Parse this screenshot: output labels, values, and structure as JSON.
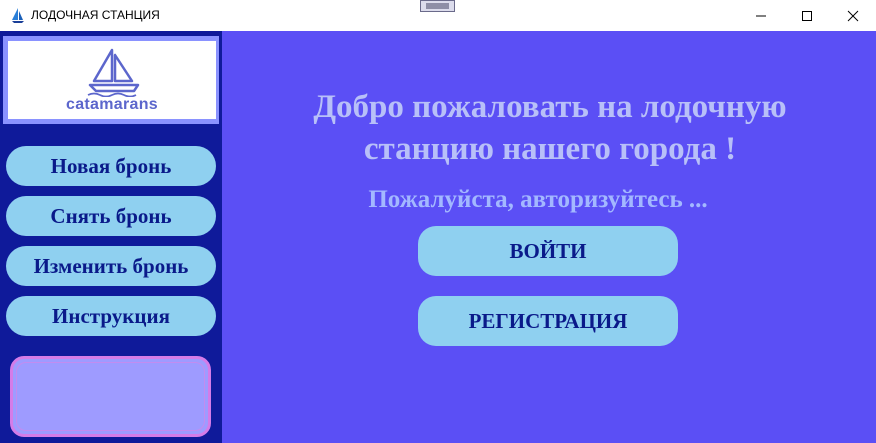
{
  "window": {
    "title": "ЛОДОЧНАЯ СТАНЦИЯ",
    "icon": "sailboat-icon",
    "controls": [
      "minimize-icon",
      "maximize-icon",
      "close-icon"
    ]
  },
  "sidebar": {
    "logo_text": "catamarans",
    "items": [
      {
        "label": "Новая бронь"
      },
      {
        "label": "Снять бронь"
      },
      {
        "label": "Изменить бронь"
      },
      {
        "label": "Инструкция"
      }
    ]
  },
  "main": {
    "heading_line1": "Добро пожаловать на лодочную",
    "heading_line2": "станцию нашего города !",
    "subheading": "Пожалуйста, авторизуйтесь ...",
    "login_label": "ВОЙТИ",
    "register_label": "РЕГИСТРАЦИЯ"
  },
  "colors": {
    "background": "#5b4ff5",
    "sidebar": "#0f1a9a",
    "button": "#8fd0f0",
    "button_text": "#0a1a8a",
    "heading": "#b8c0f8"
  }
}
